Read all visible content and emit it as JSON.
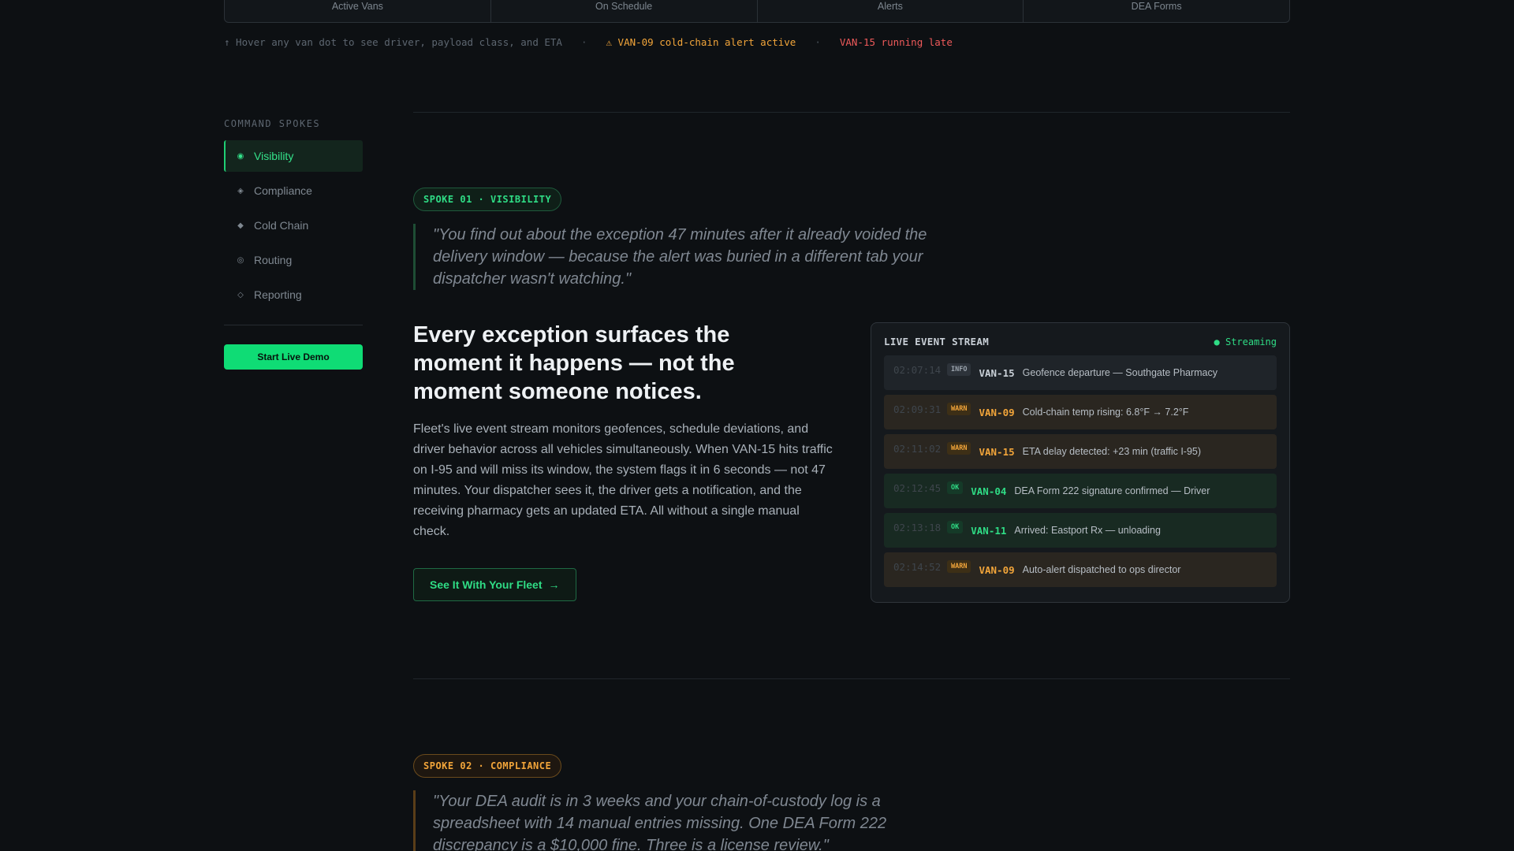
{
  "tabs": [
    "Active Vans",
    "On Schedule",
    "Alerts",
    "DEA Forms"
  ],
  "hint": {
    "text": "↑ Hover any van dot to see driver, payload class, and ETA",
    "sep": "·",
    "alert1": "⚠ VAN-09 cold-chain alert active",
    "alert2": "VAN-15 running late"
  },
  "sidebar": {
    "title": "COMMAND SPOKES",
    "items": [
      {
        "label": "Visibility",
        "glyph": "◉",
        "active": true
      },
      {
        "label": "Compliance",
        "glyph": "◈",
        "active": false
      },
      {
        "label": "Cold Chain",
        "glyph": "◆",
        "active": false
      },
      {
        "label": "Routing",
        "glyph": "◎",
        "active": false
      },
      {
        "label": "Reporting",
        "glyph": "◇",
        "active": false
      }
    ],
    "demo_button": "Start Live Demo"
  },
  "spoke1": {
    "pill": "SPOKE 01 · VISIBILITY",
    "quote": "\"You find out about the exception 47 minutes after it already voided the delivery window — because the alert was buried in a different tab your dispatcher wasn't watching.\"",
    "headline": "Every exception surfaces the moment it happens — not the moment someone notices.",
    "body": "Fleet's live event stream monitors geofences, schedule deviations, and driver behavior across all vehicles simultaneously. When VAN-15 hits traffic on I-95 and will miss its window, the system flags it in 6 seconds — not 47 minutes. Your dispatcher sees it, the driver gets a notification, and the receiving pharmacy gets an updated ETA. All without a single manual check.",
    "cta": "See It With Your Fleet",
    "cta_arrow": "→"
  },
  "stream": {
    "title": "LIVE EVENT STREAM",
    "status": "● Streaming",
    "events": [
      {
        "time": "02:07:14",
        "level": "INFO",
        "kind": "info",
        "van": "VAN-15",
        "msg": "Geofence departure — Southgate Pharmacy"
      },
      {
        "time": "02:09:31",
        "level": "WARN",
        "kind": "warn",
        "van": "VAN-09",
        "msg": "Cold-chain temp rising: 6.8°F → 7.2°F"
      },
      {
        "time": "02:11:02",
        "level": "WARN",
        "kind": "warn",
        "van": "VAN-15",
        "msg": "ETA delay detected: +23 min (traffic I-95)"
      },
      {
        "time": "02:12:45",
        "level": "OK",
        "kind": "ok",
        "van": "VAN-04",
        "msg": "DEA Form 222 signature confirmed — Driver"
      },
      {
        "time": "02:13:18",
        "level": "OK",
        "kind": "ok",
        "van": "VAN-11",
        "msg": "Arrived: Eastport Rx — unloading"
      },
      {
        "time": "02:14:52",
        "level": "WARN",
        "kind": "warn",
        "van": "VAN-09",
        "msg": "Auto-alert dispatched to ops director"
      }
    ]
  },
  "spoke2": {
    "pill": "SPOKE 02 · COMPLIANCE",
    "quote": "\"Your DEA audit is in 3 weeks and your chain-of-custody log is a spreadsheet with 14 manual entries missing. One DEA Form 222 discrepancy is a $10,000 fine. Three is a license review.\""
  }
}
